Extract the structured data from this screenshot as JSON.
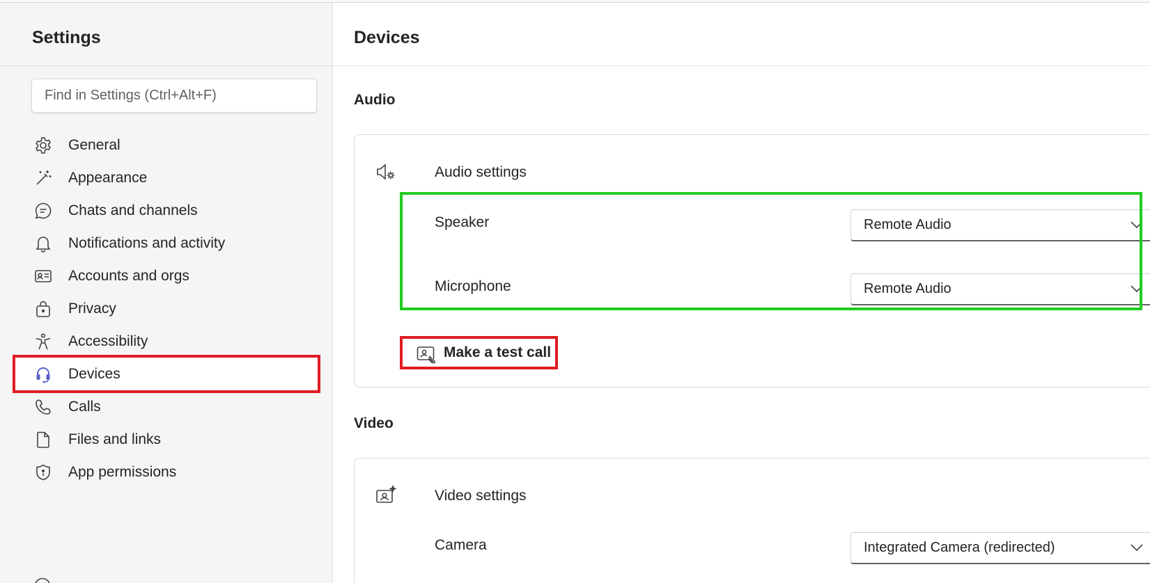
{
  "sidebar": {
    "title": "Settings",
    "search_placeholder": "Find in Settings (Ctrl+Alt+F)",
    "items": [
      {
        "label": "General",
        "icon": "gear-icon"
      },
      {
        "label": "Appearance",
        "icon": "magic-wand-icon"
      },
      {
        "label": "Chats and channels",
        "icon": "chat-bubble-icon"
      },
      {
        "label": "Notifications and activity",
        "icon": "bell-icon"
      },
      {
        "label": "Accounts and orgs",
        "icon": "id-card-icon"
      },
      {
        "label": "Privacy",
        "icon": "lock-bag-icon"
      },
      {
        "label": "Accessibility",
        "icon": "accessibility-icon"
      },
      {
        "label": "Devices",
        "icon": "headset-icon",
        "active": true
      },
      {
        "label": "Calls",
        "icon": "phone-icon"
      },
      {
        "label": "Files and links",
        "icon": "file-icon"
      },
      {
        "label": "App permissions",
        "icon": "shield-icon"
      }
    ]
  },
  "main": {
    "title": "Devices",
    "audio": {
      "section_title": "Audio",
      "card_title": "Audio settings",
      "speaker_label": "Speaker",
      "speaker_value": "Remote Audio",
      "microphone_label": "Microphone",
      "microphone_value": "Remote Audio",
      "test_call_label": "Make a test call"
    },
    "video": {
      "section_title": "Video",
      "card_title": "Video settings",
      "camera_label": "Camera",
      "camera_value": "Integrated Camera (redirected)"
    }
  },
  "colors": {
    "highlight_red": "#e01c24",
    "highlight_green": "#22cc22",
    "accent": "#5b5fc7"
  }
}
